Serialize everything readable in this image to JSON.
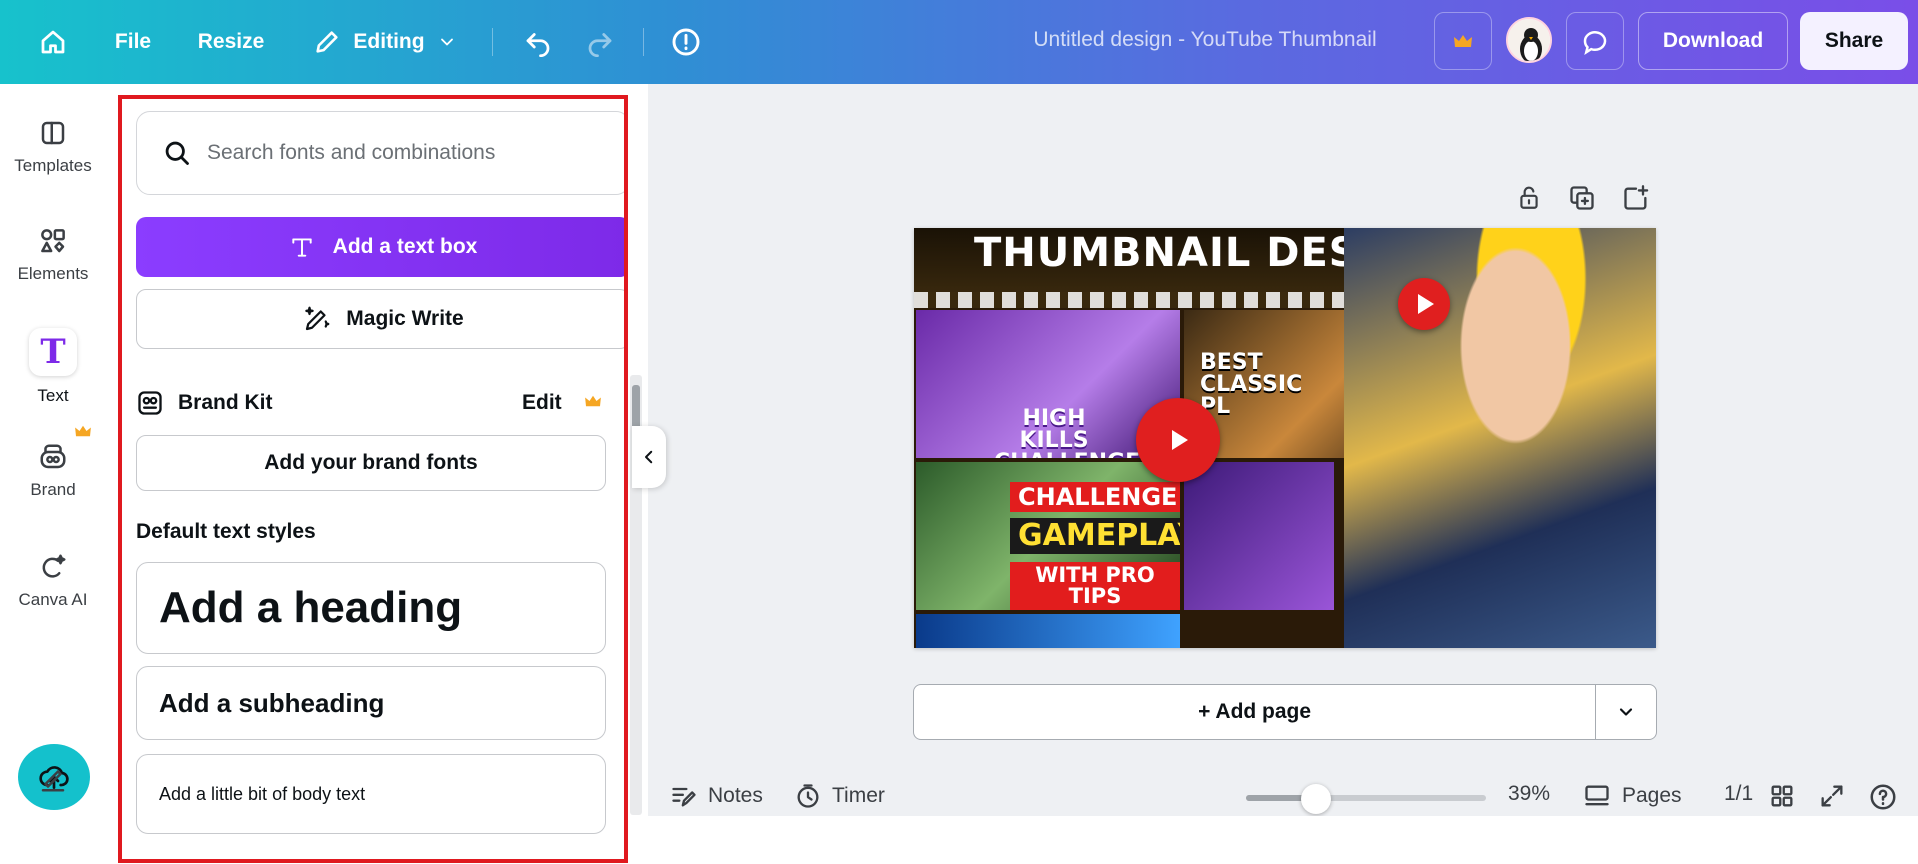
{
  "toolbar": {
    "file_label": "File",
    "resize_label": "Resize",
    "editing_label": "Editing",
    "doc_title": "Untitled design - YouTube Thumbnail",
    "download_label": "Download",
    "share_label": "Share"
  },
  "rail": {
    "items": [
      {
        "label": "Templates",
        "icon": "templates-icon"
      },
      {
        "label": "Elements",
        "icon": "elements-icon"
      },
      {
        "label": "Text",
        "icon": "text-icon"
      },
      {
        "label": "Brand",
        "icon": "brand-icon"
      },
      {
        "label": "Canva AI",
        "icon": "canva-ai-icon"
      }
    ],
    "active_glyph": "T"
  },
  "panel": {
    "search_placeholder": "Search fonts and combinations",
    "add_textbox_label": "Add a text box",
    "magic_write_label": "Magic Write",
    "brand_kit_label": "Brand Kit",
    "brand_kit_edit": "Edit",
    "add_brand_fonts": "Add your brand fonts",
    "default_styles_title": "Default text styles",
    "heading_label": "Add a heading",
    "subheading_label": "Add a subheading",
    "body_label": "Add a little bit of body text"
  },
  "design": {
    "title": "THUMBNAIL DESIGN",
    "tile1_text": "HIGH KILLS CHALLENGE",
    "tile2_text": "BEST CLASSIC PL",
    "tile3_line1": "CHALLENGE",
    "tile3_line2": "GAMEPLAY",
    "tile3_line3": "WITH PRO TIPS"
  },
  "canvas": {
    "add_page_label": "+ Add page"
  },
  "bottom": {
    "notes_label": "Notes",
    "timer_label": "Timer",
    "zoom_value": "39%",
    "zoom_fraction": 0.39,
    "pages_label": "Pages",
    "page_count": "1/1"
  },
  "colors": {
    "accent": "#7d2ae8",
    "teal": "#14c1cc",
    "highlight_border": "#e0191f"
  }
}
